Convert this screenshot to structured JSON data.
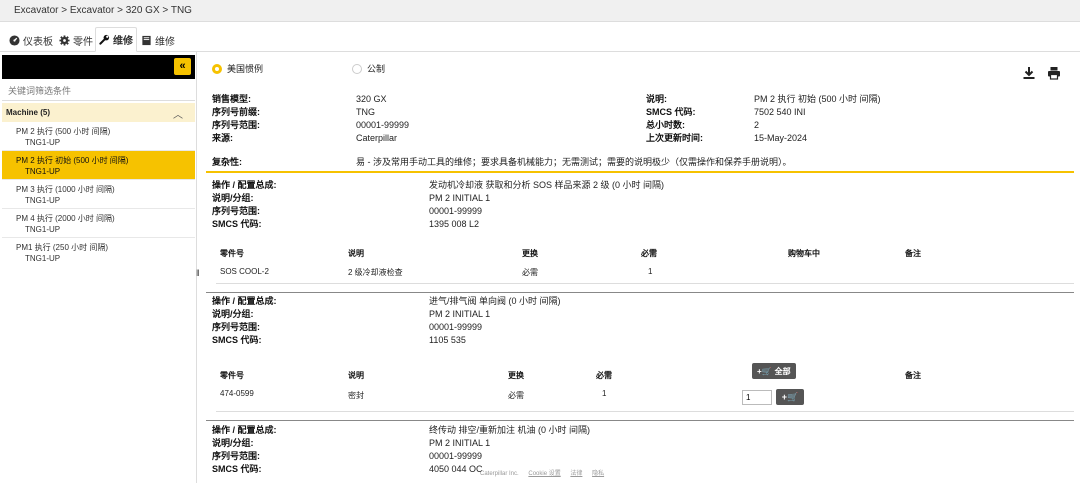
{
  "breadcrumb": "Excavator > Excavator > 320 GX > TNG",
  "tabs": [
    {
      "label": "仪表板",
      "icon": "dashboard-icon"
    },
    {
      "label": "零件",
      "icon": "gear-icon"
    },
    {
      "label": "维修",
      "icon": "wrench-icon"
    },
    {
      "label": "维修",
      "icon": "book-icon"
    }
  ],
  "sidebar": {
    "filter_placeholder": "关键词筛选条件",
    "group_title": "Machine (5)",
    "items": [
      {
        "title": "PM 2 执行 (500 小时 间隔)",
        "sub": "TNG1-UP"
      },
      {
        "title": "PM 2 执行 初始 (500 小时 间隔)",
        "sub": "TNG1-UP"
      },
      {
        "title": "PM 3 执行 (1000 小时 间隔)",
        "sub": "TNG1-UP"
      },
      {
        "title": "PM 4 执行 (2000 小时 间隔)",
        "sub": "TNG1-UP"
      },
      {
        "title": "PM1 执行 (250 小时 间隔)",
        "sub": "TNG1-UP"
      }
    ]
  },
  "units": {
    "us": "美国惯例",
    "metric": "公制",
    "selected": "us"
  },
  "summary": {
    "left": [
      {
        "k": "销售模型:",
        "v": "320 GX"
      },
      {
        "k": "序列号前缀:",
        "v": "TNG"
      },
      {
        "k": "序列号范围:",
        "v": "00001-99999"
      },
      {
        "k": "来源:",
        "v": "Caterpillar"
      }
    ],
    "right": [
      {
        "k": "说明:",
        "v": "PM 2 执行 初始 (500 小时 间隔)"
      },
      {
        "k": "SMCS 代码:",
        "v": "7502 540 INI"
      },
      {
        "k": "总小时数:",
        "v": "2"
      },
      {
        "k": "上次更新时间:",
        "v": "15-May-2024"
      }
    ],
    "complexity_label": "复杂性:",
    "complexity_value": "易 - 涉及常用手动工具的维修；要求具备机械能力；无需测试；需要的说明极少（仅需操作和保养手册说明）。"
  },
  "labels": {
    "operation": "操作 / 配置总成:",
    "desc_group": "说明/分组:",
    "serial_range": "序列号范围:",
    "smcs": "SMCS 代码:"
  },
  "ops": [
    {
      "operation": "发动机冷却液 获取和分析 SOS 样品来源 2 级 (0 小时 间隔)",
      "desc": "PM 2 INITIAL 1",
      "range": "00001-99999",
      "smcs": "1395 008 L2"
    },
    {
      "operation": "进气/排气阀 单向阀 (0 小时 间隔)",
      "desc": "PM 2 INITIAL 1",
      "range": "00001-99999",
      "smcs": "1105 535"
    },
    {
      "operation": "终传动 排空/重新加注 机油 (0 小时 间隔)",
      "desc": "PM 2 INITIAL 1",
      "range": "00001-99999",
      "smcs": "4050 044 OC"
    }
  ],
  "table1": {
    "headers": [
      "零件号",
      "说明",
      "更换",
      "必需",
      "购物车中",
      "备注"
    ],
    "row": {
      "part": "SOS COOL-2",
      "desc": "2 级冷却液检查",
      "replace": "必需",
      "required": "1"
    }
  },
  "table2": {
    "headers": [
      "零件号",
      "说明",
      "更换",
      "必需",
      "备注"
    ],
    "cart_all": "全部",
    "row": {
      "part": "474-0599",
      "desc": "密封",
      "replace": "必需",
      "required": "1",
      "qty": "1"
    }
  },
  "footer": {
    "copyright": "Caterpillar Inc.",
    "links": [
      "Cookie 设置",
      "法律",
      "隐私"
    ]
  },
  "colors": {
    "accent": "#f6c200"
  }
}
